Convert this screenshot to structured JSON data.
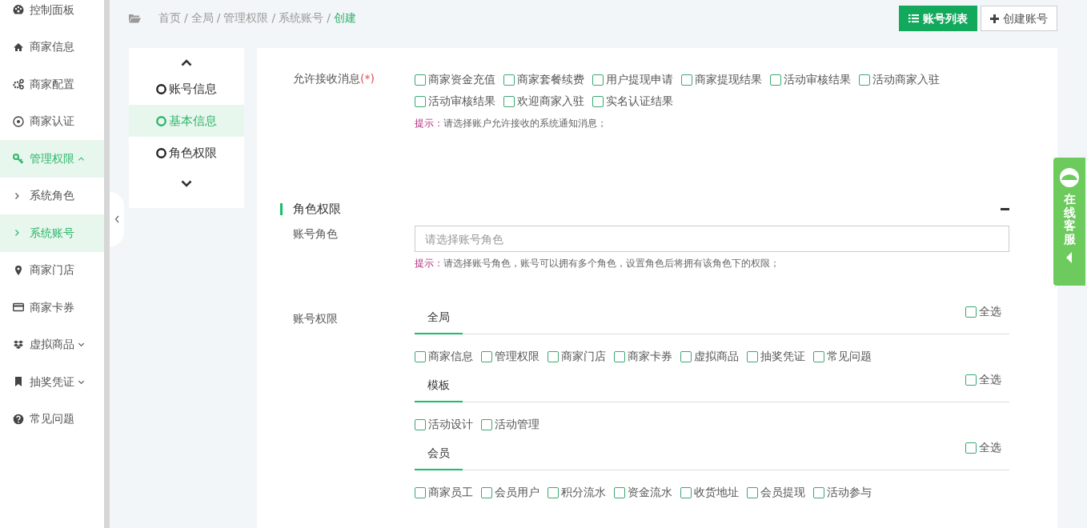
{
  "sidebar": {
    "items": [
      {
        "label": "控制面板",
        "selected": false
      },
      {
        "label": "商家信息",
        "selected": false
      },
      {
        "label": "商家配置",
        "selected": false
      },
      {
        "label": "商家认证",
        "selected": false
      },
      {
        "label": "管理权限",
        "selected": true,
        "expanded": true,
        "children": [
          {
            "label": "系统角色",
            "selected": false
          },
          {
            "label": "系统账号",
            "selected": true
          }
        ]
      },
      {
        "label": "商家门店",
        "selected": false
      },
      {
        "label": "商家卡券",
        "selected": false
      },
      {
        "label": "虚拟商品",
        "selected": false,
        "expanded": false
      },
      {
        "label": "抽奖凭证",
        "selected": false,
        "expanded": false
      },
      {
        "label": "常见问题",
        "selected": false
      }
    ]
  },
  "breadcrumb": {
    "separator": "/",
    "items": [
      {
        "label": "首页",
        "current": false
      },
      {
        "label": "全局",
        "current": false
      },
      {
        "label": "管理权限",
        "current": false
      },
      {
        "label": "系统账号",
        "current": false
      },
      {
        "label": "创建",
        "current": true
      }
    ]
  },
  "header_buttons": [
    {
      "label": "账号列表",
      "kind": "primary"
    },
    {
      "label": "创建账号",
      "kind": "default"
    }
  ],
  "step_nav": {
    "items": [
      {
        "label": "账号信息",
        "selected": false
      },
      {
        "label": "基本信息",
        "selected": true
      },
      {
        "label": "角色权限",
        "selected": false
      }
    ]
  },
  "form": {
    "messages": {
      "label": "允许接收消息",
      "required_mark": "(*)",
      "options": [
        {
          "label": "商家资金充值",
          "checked": false
        },
        {
          "label": "商家套餐续费",
          "checked": false
        },
        {
          "label": "用户提现申请",
          "checked": false
        },
        {
          "label": "商家提现结果",
          "checked": false
        },
        {
          "label": "活动审核结果",
          "checked": false
        },
        {
          "label": "活动商家入驻",
          "checked": false
        },
        {
          "label": "活动审核结果",
          "checked": false
        },
        {
          "label": "欢迎商家入驻",
          "checked": false
        },
        {
          "label": "实名认证结果",
          "checked": false
        }
      ],
      "hint": {
        "label": "提示：",
        "text": "请选择账户允许接收的系统通知消息；"
      }
    },
    "role_section": {
      "title": "角色权限",
      "collapsed": false
    },
    "account_role": {
      "label": "账号角色",
      "placeholder": "请选择账号角色",
      "hint": {
        "label": "提示：",
        "text": "请选择账号角色，账号可以拥有多个角色，设置角色后将拥有该角色下的权限；"
      }
    },
    "account_permissions": {
      "label": "账号权限",
      "groups": [
        {
          "tab": "全局",
          "select_all": {
            "label": "全选",
            "checked": false
          },
          "options": [
            {
              "label": "商家信息",
              "checked": false
            },
            {
              "label": "管理权限",
              "checked": false
            },
            {
              "label": "商家门店",
              "checked": false
            },
            {
              "label": "商家卡券",
              "checked": false
            },
            {
              "label": "虚拟商品",
              "checked": false
            },
            {
              "label": "抽奖凭证",
              "checked": false
            },
            {
              "label": "常见问题",
              "checked": false
            }
          ]
        },
        {
          "tab": "模板",
          "select_all": {
            "label": "全选",
            "checked": false
          },
          "options": [
            {
              "label": "活动设计",
              "checked": false
            },
            {
              "label": "活动管理",
              "checked": false
            }
          ]
        },
        {
          "tab": "会员",
          "select_all": {
            "label": "全选",
            "checked": false
          },
          "options": [
            {
              "label": "商家员工",
              "checked": false
            },
            {
              "label": "会员用户",
              "checked": false
            },
            {
              "label": "积分流水",
              "checked": false
            },
            {
              "label": "资金流水",
              "checked": false
            },
            {
              "label": "收货地址",
              "checked": false
            },
            {
              "label": "会员提现",
              "checked": false
            },
            {
              "label": "活动参与",
              "checked": false
            }
          ]
        }
      ]
    }
  },
  "service_widget": {
    "label": "在线客服"
  }
}
